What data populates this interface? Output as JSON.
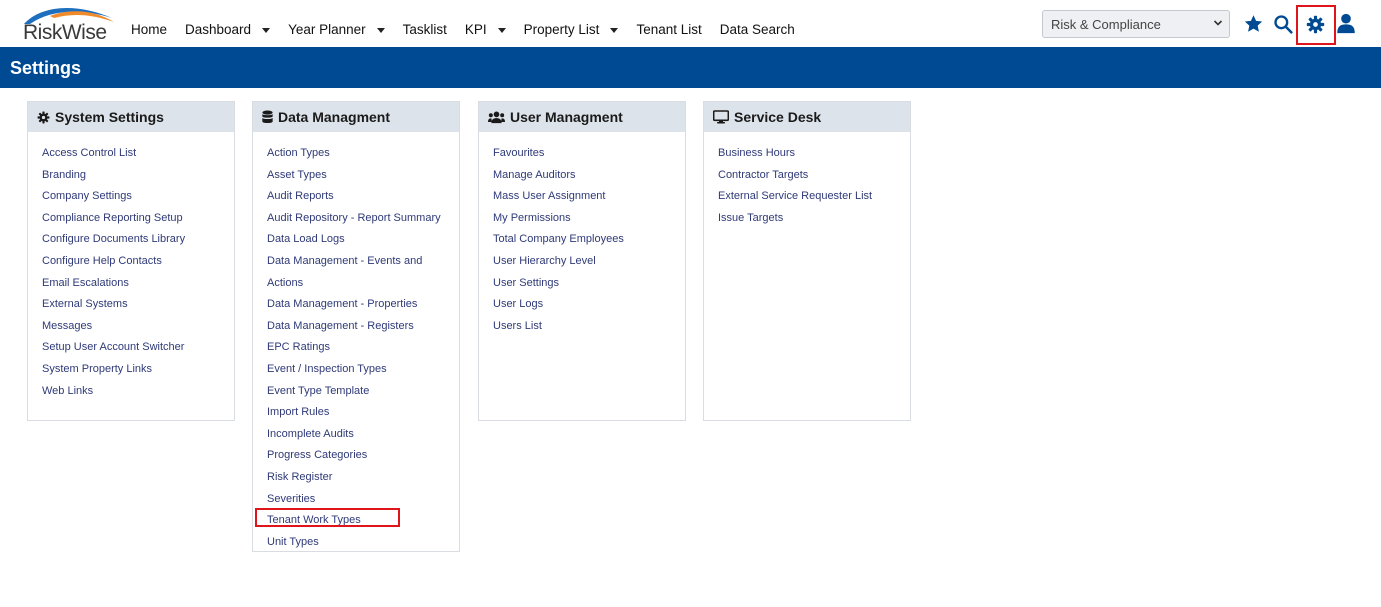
{
  "logo": {
    "text": "RiskWise"
  },
  "nav": {
    "items": [
      {
        "label": "Home",
        "dropdown": false
      },
      {
        "label": "Dashboard",
        "dropdown": true
      },
      {
        "label": "Year Planner",
        "dropdown": true
      },
      {
        "label": "Tasklist",
        "dropdown": false
      },
      {
        "label": "KPI",
        "dropdown": true
      },
      {
        "label": "Property List",
        "dropdown": true
      },
      {
        "label": "Tenant List",
        "dropdown": false
      },
      {
        "label": "Data Search",
        "dropdown": false
      }
    ]
  },
  "module_select": {
    "value": "Risk & Compliance"
  },
  "toolbar_icons": [
    "star-icon",
    "search-icon",
    "gear-icon",
    "user-icon"
  ],
  "page": {
    "title": "Settings"
  },
  "panels": [
    {
      "title": "System Settings",
      "icon": "gear-icon",
      "items": [
        "Access Control List",
        "Branding",
        "Company Settings",
        "Compliance Reporting Setup",
        "Configure Documents Library",
        "Configure Help Contacts",
        "Email Escalations",
        "External Systems",
        "Messages",
        "Setup User Account Switcher",
        "System Property Links",
        "Web Links"
      ]
    },
    {
      "title": "Data Managment",
      "icon": "database-icon",
      "items": [
        "Action Types",
        "Asset Types",
        "Audit Reports",
        "Audit Repository - Report Summary",
        "Data Load Logs",
        "Data Management - Events and Actions",
        "Data Management - Properties",
        "Data Management - Registers",
        "EPC Ratings",
        "Event / Inspection Types",
        "Event Type Template",
        "Import Rules",
        "Incomplete Audits",
        "Progress Categories",
        "Risk Register",
        "Severities",
        "Tenant Work Types",
        "Unit Types"
      ]
    },
    {
      "title": "User Managment",
      "icon": "users-icon",
      "items": [
        "Favourites",
        "Manage Auditors",
        "Mass User Assignment",
        "My Permissions",
        "Total Company Employees",
        "User Hierarchy Level",
        "User Settings",
        "User Logs",
        "Users List"
      ]
    },
    {
      "title": "Service Desk",
      "icon": "monitor-icon",
      "items": [
        "Business Hours",
        "Contractor Targets",
        "External Service Requester List",
        "Issue Targets"
      ]
    }
  ],
  "colors": {
    "brand": "#004a93",
    "link": "#2f3a78",
    "highlight": "#e0151c",
    "panel_header": "#dde3eb"
  }
}
